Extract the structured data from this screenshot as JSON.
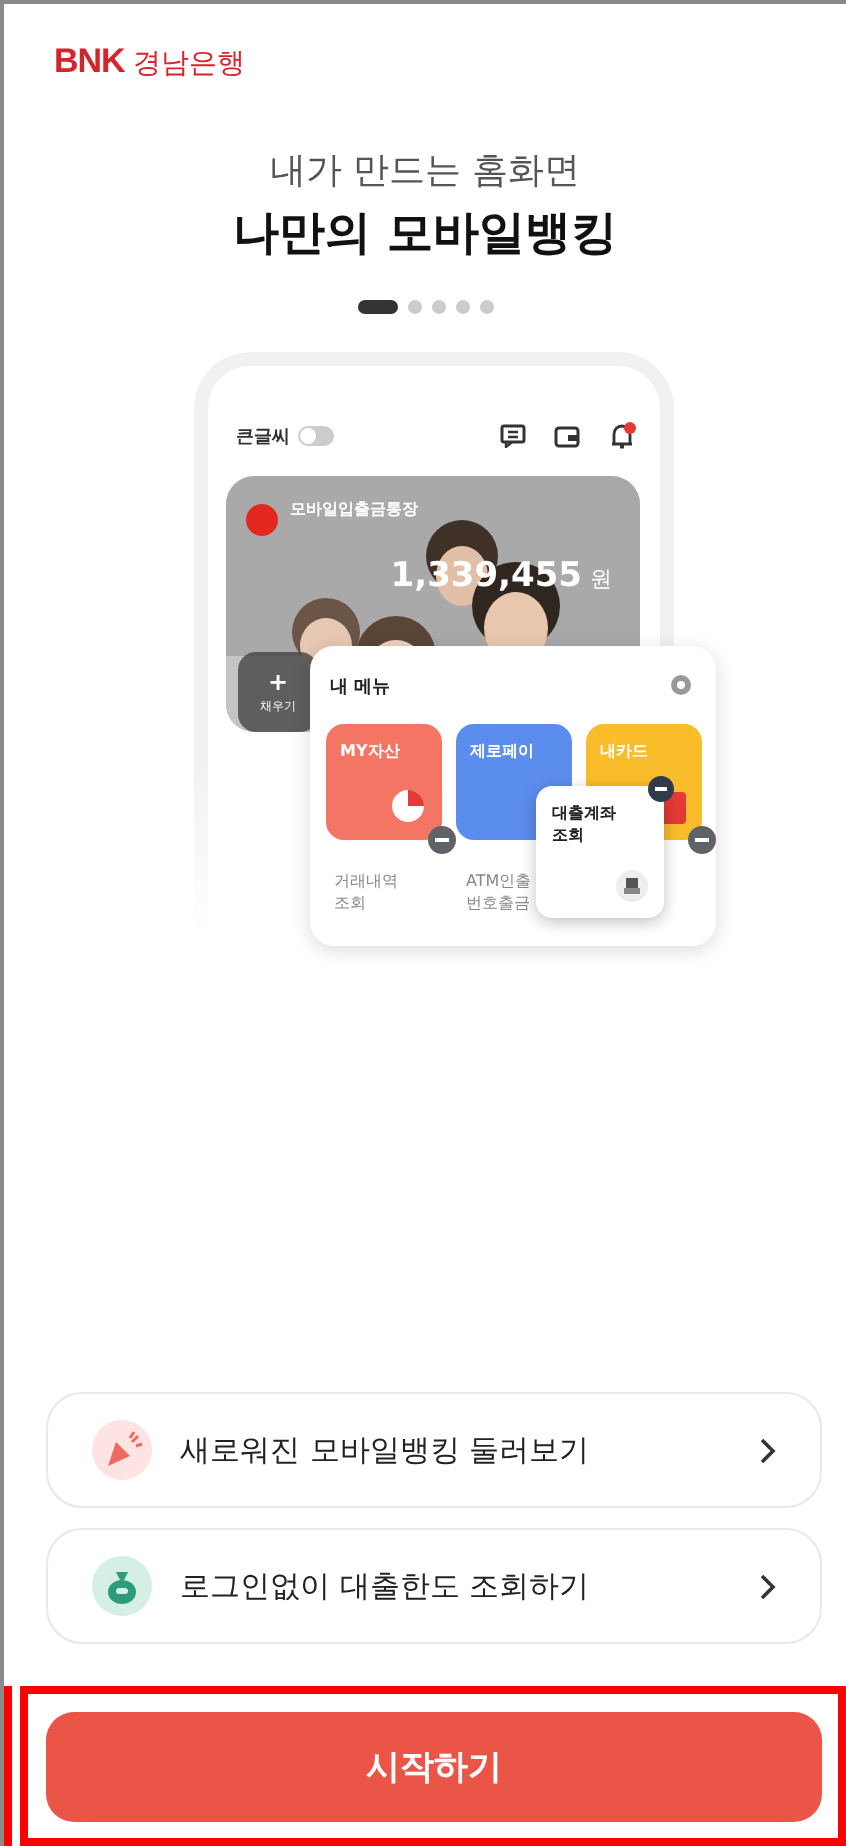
{
  "header": {
    "logo": "BNK",
    "bank_name": "경남은행"
  },
  "hero": {
    "subtitle": "내가 만드는 홈화면",
    "title": "나만의 모바일뱅킹"
  },
  "pager": [
    {
      "selected": true
    },
    {
      "selected": false
    },
    {
      "selected": false
    },
    {
      "selected": false
    },
    {
      "selected": false
    }
  ],
  "preview": {
    "large_text_label": "큰글씨",
    "large_text_on": false,
    "account": {
      "name": "모바일입출금통장",
      "balance": "1,339,455",
      "currency": "원"
    },
    "fill_button": {
      "icon": "+",
      "label": "채우기"
    },
    "my_menu": {
      "title": "내 메뉴",
      "tiles": [
        {
          "label": "MY자산",
          "color": "#f47563",
          "removable": true
        },
        {
          "label": "제로페이",
          "color": "#5b8def",
          "removable": false
        },
        {
          "label": "내카드",
          "color": "#f9bd2b",
          "removable": true
        }
      ],
      "lower_items": [
        "거래내역 조회",
        "ATM인출 번호출금"
      ],
      "popup": "대출계좌 조회"
    }
  },
  "links": [
    {
      "label": "새로워진 모바일뱅킹 둘러보기",
      "kind": "party"
    },
    {
      "label": "로그인없이 대출한도 조회하기",
      "kind": "moneybag"
    }
  ],
  "start_button": "시작하기"
}
